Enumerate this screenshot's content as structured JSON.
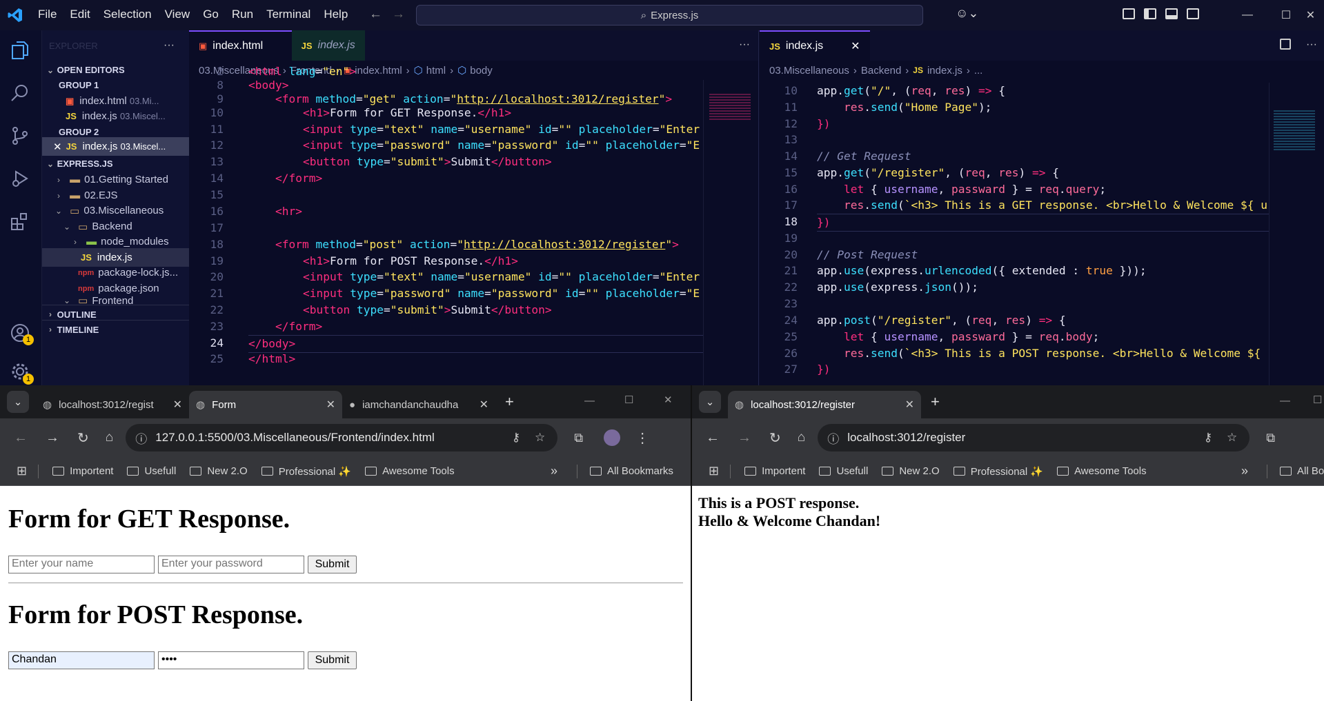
{
  "titlebar": {
    "menu": [
      "File",
      "Edit",
      "Selection",
      "View",
      "Go",
      "Run",
      "Terminal",
      "Help"
    ],
    "search": "Express.js"
  },
  "activity": {
    "badge_account": "1",
    "badge_settings": "1"
  },
  "sidebar": {
    "title": "EXPLORER",
    "open_editors": "OPEN EDITORS",
    "group1": "GROUP 1",
    "g1_item1": "index.html",
    "g1_item1_path": "03.Mi...",
    "g1_item2": "index.js",
    "g1_item2_path": "03.Miscel...",
    "group2": "GROUP 2",
    "g2_item1": "index.js",
    "g2_item1_path": "03.Miscel...",
    "project": "EXPRESS.JS",
    "tree": [
      "01.Getting Started",
      "02.EJS",
      "03.Miscellaneous",
      "Backend",
      "node_modules",
      "index.js",
      "package-lock.js...",
      "package.json",
      "Frontend"
    ],
    "outline": "OUTLINE",
    "timeline": "TIMELINE"
  },
  "left_editor": {
    "tab_active": "index.html",
    "tab_inactive": "index.js",
    "crumbs": [
      "03.Miscellaneous",
      "Frontend",
      "index.html",
      "html",
      "body"
    ],
    "line_numbers": [
      "2",
      "8",
      "9",
      "10",
      "11",
      "12",
      "13",
      "14",
      "15",
      "16",
      "17",
      "18",
      "19",
      "20",
      "21",
      "22",
      "23",
      "24",
      "25"
    ],
    "current_line": "24"
  },
  "right_editor": {
    "tab_active": "index.js",
    "crumbs": [
      "03.Miscellaneous",
      "Backend",
      "index.js",
      "..."
    ],
    "line_numbers": [
      "10",
      "11",
      "12",
      "13",
      "14",
      "15",
      "16",
      "17",
      "18",
      "19",
      "20",
      "21",
      "22",
      "23",
      "24",
      "25",
      "26",
      "27"
    ],
    "current_line": "18"
  },
  "browser_left": {
    "tabs": [
      "localhost:3012/regist",
      "Form",
      "iamchandanchaudha"
    ],
    "url": "127.0.0.1:5500/03.Miscellaneous/Frontend/index.html",
    "bookmarks": [
      "Importent",
      "Usefull",
      "New 2.O",
      "Professional ✨",
      "Awesome Tools"
    ],
    "all_bookmarks": "All Bookmarks",
    "h1_get": "Form for GET Response.",
    "h1_post": "Form for POST Response.",
    "ph_name": "Enter your name",
    "ph_password": "Enter your password",
    "submit": "Submit",
    "post_name_value": "Chandan",
    "post_password_value": "••••"
  },
  "browser_right": {
    "tab": "localhost:3012/register",
    "url": "localhost:3012/register",
    "bookmarks": [
      "Importent",
      "Usefull",
      "New 2.O",
      "Professional ✨",
      "Awesome Tools"
    ],
    "all_bookmarks": "All Bo",
    "response_line1": "This is a POST response.",
    "response_line2": "Hello & Welcome Chandan!"
  }
}
